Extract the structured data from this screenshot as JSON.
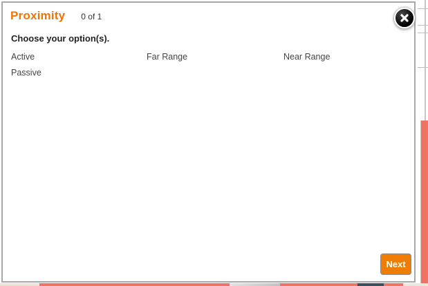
{
  "dialog": {
    "title": "Proximity",
    "counter": "0 of 1",
    "prompt": "Choose your option(s).",
    "options": [
      "Active",
      "Far Range",
      "Near Range",
      "Passive"
    ],
    "next_button_label": "Next"
  },
  "icons": {
    "close": "close-icon"
  },
  "colors": {
    "title_orange": "#ee7505",
    "next_button_orange": "#ee7d02",
    "dialog_border_gray": "#a8a8a8",
    "background_salmon": "#ef7262",
    "background_navy": "#3d4d5e",
    "background_beige": "#ebe5d6"
  }
}
